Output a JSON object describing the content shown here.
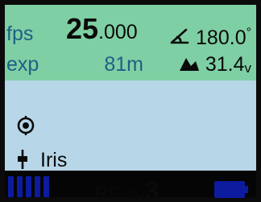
{
  "colors": {
    "top_background": "#7fcfa4",
    "middle_background": "#b7d6e7",
    "label": "#1f5f86",
    "value": "#0a0a0a",
    "accent_blue": "#0d1b9e"
  },
  "readout": {
    "fps_label": "fps",
    "fps_integer": "25",
    "fps_decimal": ".000",
    "shutter_icon": "shutter-angle-icon",
    "shutter_value": "180.0",
    "shutter_unit": "°",
    "exp_label": "exp",
    "exp_value": "81m",
    "temp_icon": "white-balance-icon",
    "temp_value": "31.4",
    "temp_unit": "v"
  },
  "status": {
    "target_icon": "target-icon",
    "lens_icon": "lens-icon",
    "lens_label": "Iris"
  },
  "footer": {
    "signal_bars": 5,
    "rf_label": "RF-",
    "rf_label_small": "CH",
    "rf_channel": "3",
    "battery_icon": "battery-icon"
  }
}
